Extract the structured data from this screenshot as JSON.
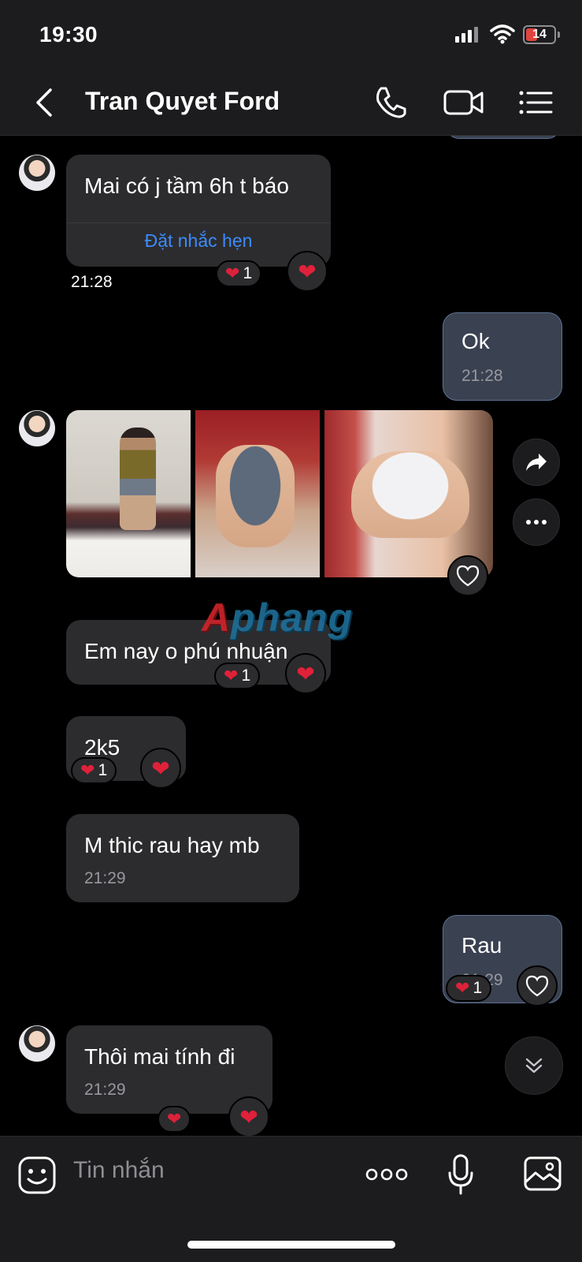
{
  "status_bar": {
    "time": "19:30",
    "battery": "14"
  },
  "header": {
    "title": "Tran Quyet Ford"
  },
  "messages": [
    {
      "text": "Mai có j tầm 6h t báo",
      "action": "Đặt nhắc hẹn",
      "time": "21:28",
      "reaction_count": "1"
    },
    {
      "text": "Ok",
      "time": "21:28"
    },
    {
      "text": "Em nay o phú nhuận",
      "reaction_count": "1"
    },
    {
      "text": "2k5",
      "reaction_count": "1"
    },
    {
      "text": "M thic rau hay mb",
      "time": "21:29"
    },
    {
      "text": "Rau",
      "time": "21:29",
      "reaction_count": "1"
    },
    {
      "text": "Thôi mai tính đi",
      "time": "21:29"
    }
  ],
  "watermark": {
    "first": "A",
    "rest": "phang"
  },
  "input": {
    "placeholder": "Tin nhắn"
  },
  "colors": {
    "accent": "#3d8bfd",
    "heart": "#e0213a",
    "bubble_in": "#2c2c2e",
    "bubble_out": "#3a4150"
  }
}
